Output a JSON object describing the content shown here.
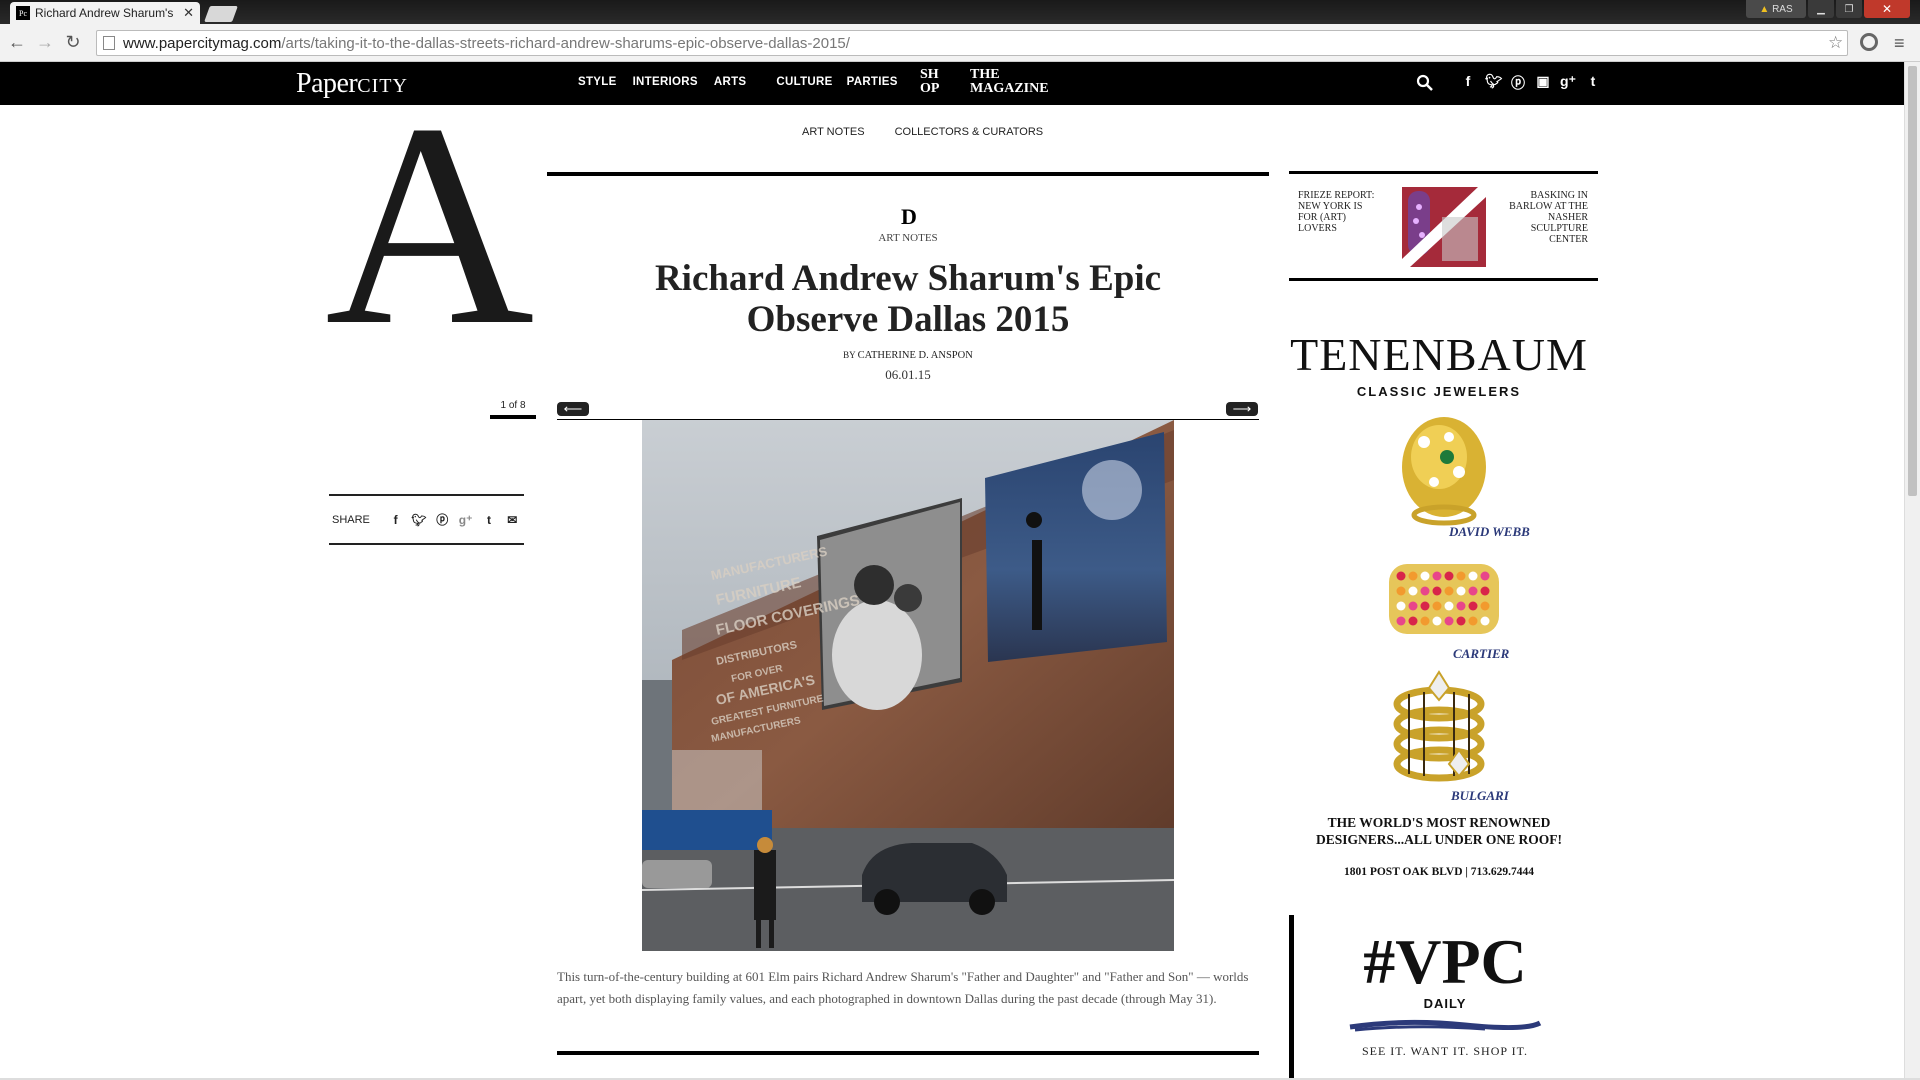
{
  "browser": {
    "tab_title": "Richard Andrew Sharum's",
    "favicon_text": "Pc",
    "url_domain": "www.papercitymag.com",
    "url_path": "/arts/taking-it-to-the-dallas-streets-richard-andrew-sharums-epic-observe-dallas-2015/",
    "user_badge": "RAS"
  },
  "site": {
    "logo_main": "Paper",
    "logo_city": "CITY",
    "nav": [
      "STYLE",
      "INTERIORS",
      "ARTS",
      "CULTURE",
      "PARTIES"
    ],
    "shop_line1": "SH",
    "shop_line2": "OP",
    "magazine_line1": "THE",
    "magazine_line2": "MAGAZINE",
    "subnav": [
      "ART NOTES",
      "COLLECTORS & CURATORS"
    ],
    "section_letter": "A"
  },
  "article": {
    "city_mark": "D",
    "section": "ART NOTES",
    "headline": "Richard Andrew Sharum's Epic Observe Dallas 2015",
    "byline_prefix": "BY ",
    "byline_author": "CATHERINE D. ANSPON",
    "date": "06.01.15",
    "slide_counter": "1 of 8",
    "caption": "This turn-of-the-century building at 601 Elm pairs Richard Andrew Sharum's \"Father and Daughter\" and \"Father and Son\" — worlds apart, yet both displaying family values, and each photographed in downtown Dallas during the past decade (through May 31).",
    "mural_text": [
      "MANUFACTURERS",
      "FURNITURE",
      "FLOOR COVERINGS",
      "DISTRIBUTORS",
      "FOR OVER",
      "OF AMERICA'S",
      "GREATEST FURNITURE",
      "MANUFACTURERS"
    ],
    "share_label": "SHARE"
  },
  "sidebar": {
    "promo_left": "FRIEZE REPORT: NEW YORK IS FOR (ART) LOVERS",
    "promo_right": "BASKING IN BARLOW AT THE NASHER SCULPTURE CENTER"
  },
  "ad": {
    "brand": "TENENBAUM",
    "subtitle": "CLASSIC JEWELERS",
    "ring1": "DAVID WEBB",
    "ring2": "CARTIER",
    "ring3": "BULGARI",
    "tagline_1": "THE WORLD'S MOST RENOWNED",
    "tagline_2": "DESIGNERS...ALL UNDER ONE ROOF!",
    "address": "1801 POST OAK BLVD  |  713.629.7444"
  },
  "vpc": {
    "title": "#VPC",
    "daily": "DAILY",
    "tagline": "SEE IT. WANT IT. SHOP IT."
  },
  "colors": {
    "nav_bg": "#000000",
    "accent_blue": "#2c3a7a"
  }
}
